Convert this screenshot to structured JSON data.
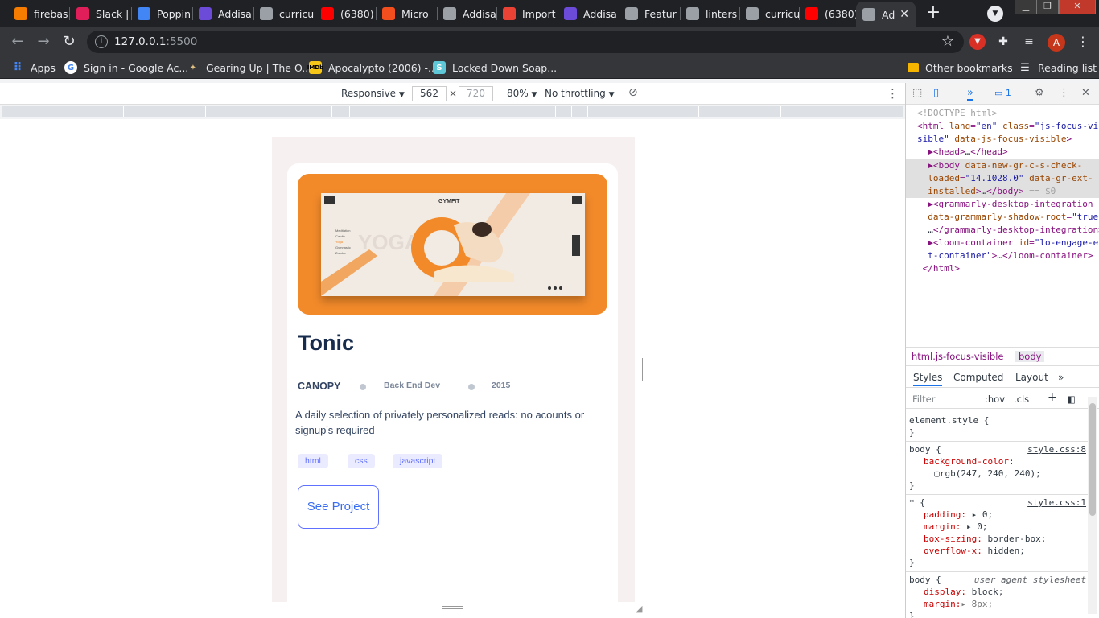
{
  "tabs": [
    {
      "title": "firebas",
      "icon": "firebase-icon",
      "color": "#f57c00"
    },
    {
      "title": "Slack |",
      "icon": "slack-icon",
      "color": "#e01e5a"
    },
    {
      "title": "Poppin",
      "icon": "google-fonts-icon",
      "color": "#4285f4"
    },
    {
      "title": "Addisa",
      "icon": "addis-icon",
      "color": "#6b4bd8"
    },
    {
      "title": "curricu",
      "icon": "github-icon",
      "color": "#9aa0a6"
    },
    {
      "title": "(6380)",
      "icon": "youtube-icon",
      "color": "#ff0000"
    },
    {
      "title": "Micro",
      "icon": "figma-icon",
      "color": "#f24e1e"
    },
    {
      "title": "Addisa",
      "icon": "globe-icon",
      "color": "#9aa0a6"
    },
    {
      "title": "Import",
      "icon": "gmail-icon",
      "color": "#ea4335"
    },
    {
      "title": "Addisa",
      "icon": "addis-icon",
      "color": "#6b4bd8"
    },
    {
      "title": "Featur",
      "icon": "github-icon",
      "color": "#9aa0a6"
    },
    {
      "title": "linters",
      "icon": "github-icon",
      "color": "#9aa0a6"
    },
    {
      "title": "curricu",
      "icon": "github-icon",
      "color": "#9aa0a6"
    },
    {
      "title": "(6380)",
      "icon": "youtube-icon",
      "color": "#ff0000"
    },
    {
      "title": "Ad",
      "icon": "globe-icon",
      "color": "#9aa0a6",
      "active": true
    }
  ],
  "toolbar": {
    "url_host": "127.0.0.1",
    "url_port": ":5500",
    "avatar_letter": "A"
  },
  "bookmarks": [
    {
      "label": "Apps",
      "icon": "apps-grid-icon"
    },
    {
      "label": "Sign in - Google Ac...",
      "icon": "google-icon"
    },
    {
      "label": "Gearing Up | The O...",
      "icon": "gearing-up-icon"
    },
    {
      "label": "Apocalypto (2006) -...",
      "icon": "imdb-icon"
    },
    {
      "label": "Locked Down Soap...",
      "icon": "s-icon"
    }
  ],
  "bookmarks_right": {
    "other": "Other bookmarks",
    "reading": "Reading list"
  },
  "device_toolbar": {
    "mode": "Responsive",
    "width": "562",
    "times": "×",
    "height_placeholder": "720",
    "zoom": "80%",
    "throttling": "No throttling"
  },
  "card": {
    "title": "Tonic",
    "company": "CANOPY",
    "role": "Back End Dev",
    "year": "2015",
    "description": "A daily selection of privately personalized reads: no acounts or signup's required",
    "tags": [
      "html",
      "css",
      "javascript"
    ],
    "button": "See Project",
    "hero": {
      "brand": "GYMFIT",
      "menu": [
        "Meditation",
        "Cardio",
        "Yoga",
        "Gymnastic",
        "Zumba"
      ],
      "bg_word": "YOGA"
    }
  },
  "devtools": {
    "issues_count": "1",
    "elements": [
      {
        "html": "<span class='cm'>&lt;!DOCTYPE html&gt;</span>"
      },
      {
        "html": "&lt;html <span class='an'>lang</span>=<span class='av'>\"en\"</span> <span class='an'>class</span>=<span class='av'>\"js-focus-vi</span>"
      },
      {
        "html": "<span class='av'>sible\"</span> <span class='an'>data-js-focus-visible</span>&gt;"
      },
      {
        "html": "  ▶&lt;head&gt;<span class='tx'>…</span>&lt;/head&gt;"
      },
      {
        "html": "  ▶&lt;body <span class='an'>data-new-gr-c-s-check-</span>",
        "sel": true
      },
      {
        "html": "  <span class='an'>loaded</span>=<span class='av'>\"14.1028.0\"</span> <span class='an'>data-gr-ext-</span>",
        "sel": true
      },
      {
        "html": "  <span class='an'>installed</span>&gt;<span class='tx'>…</span>&lt;/body&gt; <span class='cm'>== $0</span>",
        "sel": true
      },
      {
        "html": "  ▶&lt;grammarly-desktop-integration"
      },
      {
        "html": "  <span class='an'>data-grammarly-shadow-root</span>=<span class='av'>\"true\"</span>&gt;"
      },
      {
        "html": "  <span class='tx'>…</span>&lt;/grammarly-desktop-integration&gt;"
      },
      {
        "html": "  ▶&lt;loom-container <span class='an'>id</span>=<span class='av'>\"lo-engage-ex</span>"
      },
      {
        "html": "  <span class='av'>t-container\"</span>&gt;<span class='tx'>…</span>&lt;/loom-container&gt;"
      },
      {
        "html": " &lt;/html&gt;"
      }
    ],
    "crumbs": [
      "html.js-focus-visible",
      "body"
    ],
    "subtabs": [
      "Styles",
      "Computed",
      "Layout",
      "»"
    ],
    "filter_placeholder": "Filter",
    "hov": ":hov",
    "cls": ".cls",
    "rules": [
      {
        "selector": "element.style {",
        "source": "",
        "props": [],
        "close": "}"
      },
      {
        "selector": "body {",
        "source": "style.css:8",
        "props": [
          "background-color:",
          "  ▢rgb(247, 240, 240);"
        ],
        "close": "}"
      },
      {
        "selector": "* {",
        "source": "style.css:1",
        "props": [
          "padding: ▸ 0;",
          "margin: ▸ 0;",
          "box-sizing: border-box;",
          "overflow-x: hidden;"
        ],
        "close": "}"
      },
      {
        "selector": "body {",
        "source": "user agent stylesheet",
        "props": [
          "display: block;",
          "margin:▸ 8px;"
        ],
        "close": "}"
      }
    ]
  }
}
